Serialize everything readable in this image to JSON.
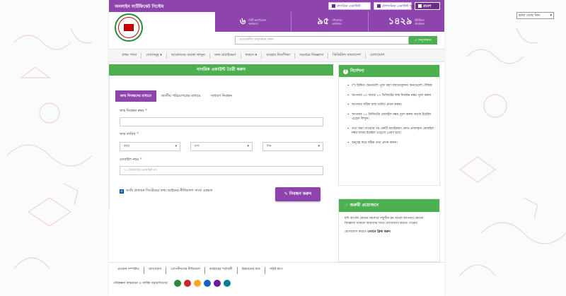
{
  "language_select": {
    "value": "ভাষা বেছে নিন"
  },
  "topbar": {
    "system_name": "অনলাইন সার্টিফিকেট সিস্টেম",
    "citizen_account_label": "নাগরিক একাউন্ট",
    "admin_account_label": "প্রশাসনিক একাউন্ট খুলুন",
    "login_label": "প্রবেশ"
  },
  "stats": [
    {
      "num": "৬",
      "label": "সিটি কর্পোরেশন\nকার্যক্রমে"
    },
    {
      "num": "৯৫",
      "label": "পৌরসভা\nকার্যক্রমে"
    },
    {
      "num": "১৪২৯",
      "label": "ইউনিয়ন\nকার্যক্রমে"
    }
  ],
  "search": {
    "placeholder": "প্রয়োজনীয় অনুসন্ধান করুন",
    "button_label": "অনুসন্ধান"
  },
  "nav": [
    "প্রথম পাতা",
    "সেবাসমূহ",
    "আবেদনের অবস্থা জানুন",
    "সনদ যাচাইকরণ",
    "ফরমস",
    "ব্যবহার নির্দেশিকা",
    "সচরাচর জিজ্ঞাসা",
    "ডিজিটাল বাংলাদেশ",
    "যোগাযোগ"
  ],
  "form": {
    "title": "নাগরিক একাউন্ট তৈরী করুন",
    "tabs": [
      "জন্ম নিবন্ধনের মাধ্যমে",
      "জাতীয় পরিচয়পত্রের মাধ্যমে",
      "সাধারণ নিবন্ধন"
    ],
    "birth_reg_label": "জন্ম নিবন্ধন নম্বর",
    "birth_date_label": "জন্ম তারিখ",
    "year_label": "বছর",
    "month_label": "মাস",
    "day_label": "দিন",
    "mobile_label": "মোবাইল নম্বর",
    "mobile_placeholder": "১১ ডিজিটের মোবাইল নং",
    "agree_label": "আমি প্রত্যয়ন সিস্টেমের তথ্য আইনের নীতিমালা সাথে একমত",
    "submit_label": "নিবন্ধন করুন",
    "required_mark": "*"
  },
  "guide": {
    "title": "নির্দেশনা",
    "items": [
      "(*) চিহ্নিত ক্ষেত্রগুলি পূরণ করা বাধ্যতামূলক। অন্যগুলো ঐচ্ছিক",
      "আপনার ১০ অথবা ১৭ ডিজিটের জন্ম নিবন্ধন নম্বর পূরণ করুন",
      "আপনার সঠিক জন্ম তারিখ প্রদান করুন।",
      "আপনার ১১ ডিজিটের মোবাইল নম্বর পূরণ করুন অথবা ইমেইল এড্রেস লিখুন।",
      "তথ্য জমা দেওয়ার পর একটি যাচাইকরণ কোড প্রদানকৃত মোবাইল নম্বর অথবা ইমেইল এড্রেসে প্রেরণ হবে।",
      "অনুগ্রহ করে সঠিক তথ্য প্রদান করুন।"
    ]
  },
  "need": {
    "title": "জরুরী প্রয়োজনে",
    "text": "যদি আপনি কোনো সমস্যার সম্মুখীন হন অথবা আপনার কোনো জিজ্ঞাসা থাকলে আমাদের সাথে যোগাযোগ করতে পারেন।",
    "call_prefix": "যোগাযোগ করতে",
    "call_link": "এখানে ক্লিক করুন"
  },
  "footer": {
    "links": [
      "প্রত্যয়ন সম্পর্কিত",
      "যোগাযোগ",
      "গোপনীয়তার নীতিমালা",
      "ব্যবহারের শর্তাবলী",
      "উদ্ভাবনের কথা",
      "সাইট ম্যাপ"
    ],
    "partners_label": "পরিকল্পনা বাস্তবায়ন ও সার্বিক সহযোগিতায়:"
  },
  "colors": {
    "brand": "#8e44ad",
    "accent": "#4caf50",
    "required": "#e53935"
  }
}
